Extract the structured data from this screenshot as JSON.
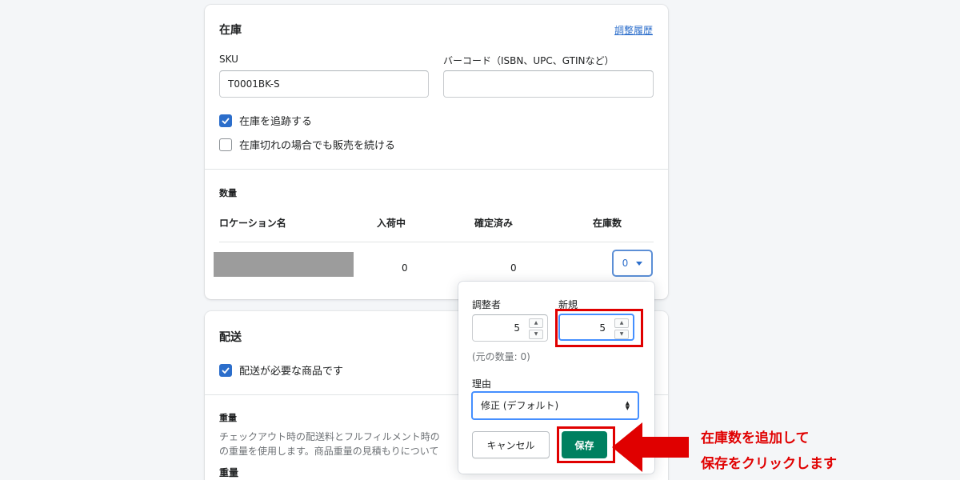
{
  "inventory": {
    "title": "在庫",
    "history_link": "調整履歴",
    "sku_label": "SKU",
    "sku_value": "T0001BK-S",
    "barcode_label": "バーコード（ISBN、UPC、GTINなど）",
    "barcode_value": "",
    "track_label": "在庫を追跡する",
    "track_checked": true,
    "continue_label": "在庫切れの場合でも販売を続ける",
    "continue_checked": false,
    "quantity_heading": "数量",
    "columns": [
      "ロケーション名",
      "入荷中",
      "確定済み",
      "在庫数"
    ],
    "row": {
      "incoming": "0",
      "committed": "0",
      "available": "0"
    }
  },
  "shipping": {
    "title": "配送",
    "physical_label": "配送が必要な商品です",
    "physical_checked": true,
    "weight_heading": "重量",
    "weight_help_line1": "チェックアウト時の配送料とフルフィルメント時の",
    "weight_help_line2": "の重量を使用します。商品重量の見積もりについて",
    "weight_label": "重量"
  },
  "popover": {
    "adjust_label": "調整者",
    "adjust_value": "5",
    "new_label": "新規",
    "new_value": "5",
    "original_qty": "(元の数量: 0)",
    "reason_label": "理由",
    "reason_value": "修正 (デフォルト)",
    "cancel_label": "キャンセル",
    "save_label": "保存"
  },
  "annotation": {
    "line1": "在庫数を追加して",
    "line2": "保存をクリックします",
    "color": "#e00000"
  },
  "colors": {
    "accent": "#2c6ecb",
    "primary_button": "#008060",
    "highlight": "#e00000"
  }
}
